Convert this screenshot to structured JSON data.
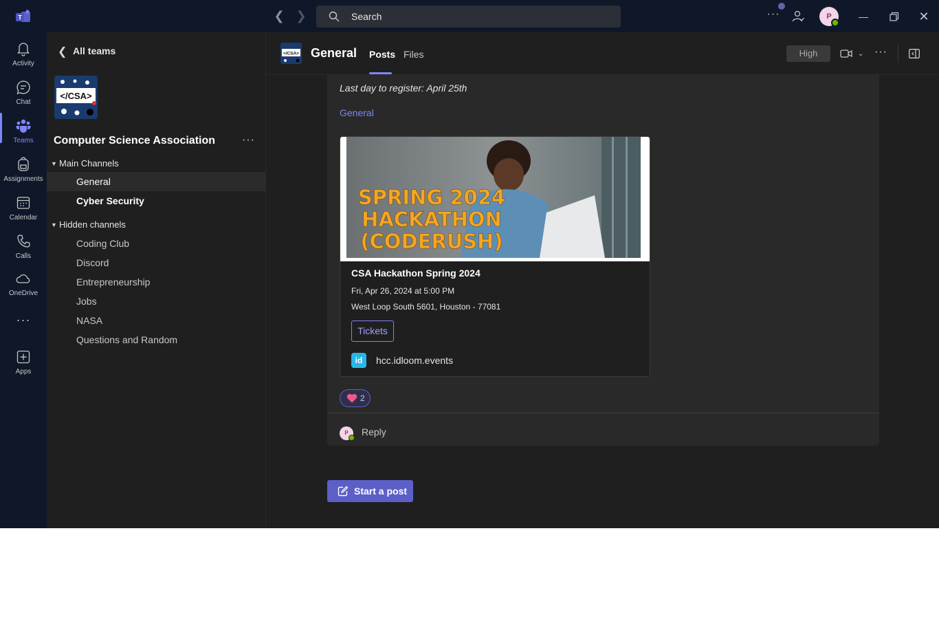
{
  "titlebar": {
    "search_placeholder": "Search",
    "avatar_initial": "P"
  },
  "rail": {
    "items": [
      {
        "label": "Activity",
        "icon": "bell-icon"
      },
      {
        "label": "Chat",
        "icon": "chat-icon"
      },
      {
        "label": "Teams",
        "icon": "teams-icon",
        "active": true
      },
      {
        "label": "Assignments",
        "icon": "backpack-icon"
      },
      {
        "label": "Calendar",
        "icon": "calendar-icon"
      },
      {
        "label": "Calls",
        "icon": "phone-icon"
      },
      {
        "label": "OneDrive",
        "icon": "cloud-icon"
      },
      {
        "label": "Apps",
        "icon": "plus-square-icon"
      }
    ]
  },
  "teampanel": {
    "back_label": "All teams",
    "team_name": "Computer Science Association",
    "team_logo_text": "</CSA>",
    "groups": [
      {
        "label": "Main Channels"
      },
      {
        "label": "Hidden channels"
      }
    ],
    "main_channels": [
      {
        "label": "General",
        "selected": true
      },
      {
        "label": "Cyber Security",
        "bold": true
      }
    ],
    "hidden_channels": [
      {
        "label": "Coding Club"
      },
      {
        "label": "Discord"
      },
      {
        "label": "Entrepreneurship"
      },
      {
        "label": "Jobs"
      },
      {
        "label": "NASA"
      },
      {
        "label": "Questions and Random"
      }
    ]
  },
  "header": {
    "channel_title": "General",
    "tabs": [
      {
        "label": "Posts",
        "active": true
      },
      {
        "label": "Files"
      }
    ],
    "quality_label": "High"
  },
  "post": {
    "text_line": "Last day to register: April 25th",
    "channel_tag": "General",
    "event": {
      "banner_lines": [
        "SPRING 2024",
        "HACKATHON",
        "(CODERUSH)"
      ],
      "title": "CSA Hackathon Spring 2024",
      "date": "Fri, Apr 26, 2024 at 5:00 PM",
      "address": "West Loop South 5601, Houston - 77081",
      "tickets_label": "Tickets",
      "source_icon_text": "id",
      "source_domain": "hcc.idloom.events"
    },
    "reaction": {
      "emoji": "heart",
      "count": "2"
    },
    "reply_avatar": "P",
    "reply_label": "Reply"
  },
  "actions": {
    "start_post_label": "Start a post"
  },
  "colors": {
    "accent": "#7f85f5",
    "primary_button": "#5b5fc7",
    "chrome": "#0f1829",
    "banner_text": "#f5a623"
  }
}
